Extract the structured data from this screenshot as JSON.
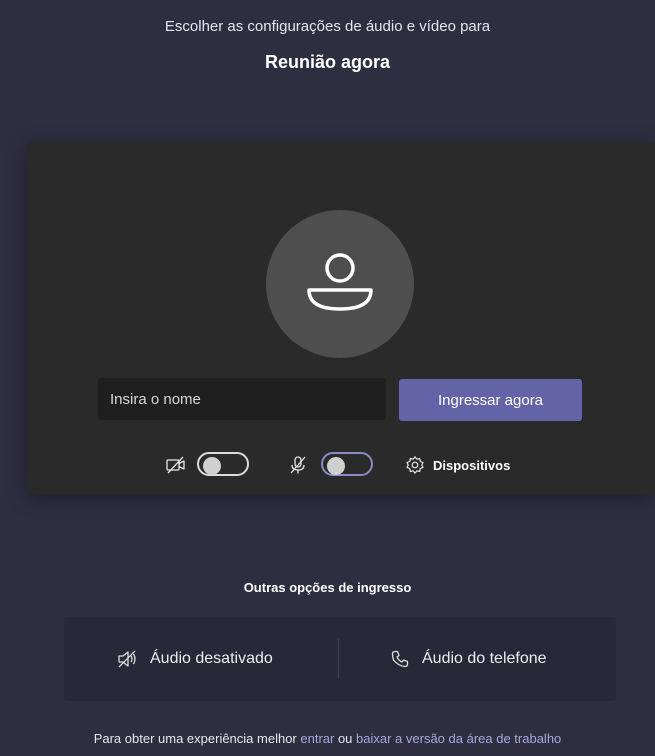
{
  "header": {
    "subtitle": "Escolher as configurações de áudio e vídeo para",
    "meeting_title": "Reunião agora"
  },
  "preview": {
    "name_placeholder": "Insira o nome",
    "join_label": "Ingressar agora",
    "video_toggle_on": false,
    "mic_toggle_on": false,
    "devices_label": "Dispositivos"
  },
  "other_options": {
    "title": "Outras opções de ingresso",
    "audio_off_label": "Áudio desativado",
    "phone_audio_label": "Áudio do telefone"
  },
  "footer": {
    "prefix": "Para obter uma experiência melhor ",
    "signin_link": "entrar",
    "middle": " ou ",
    "download_link": "baixar a versão da área de trabalho"
  },
  "colors": {
    "background": "#2f2e41",
    "card": "#2a2a2a",
    "accent": "#6264a7",
    "link": "#a6a7dc"
  },
  "icons": {
    "avatar": "person-icon",
    "video": "video-off-icon",
    "mic": "mic-off-icon",
    "devices": "gear-icon",
    "audio_off": "speaker-off-icon",
    "phone": "phone-icon"
  }
}
